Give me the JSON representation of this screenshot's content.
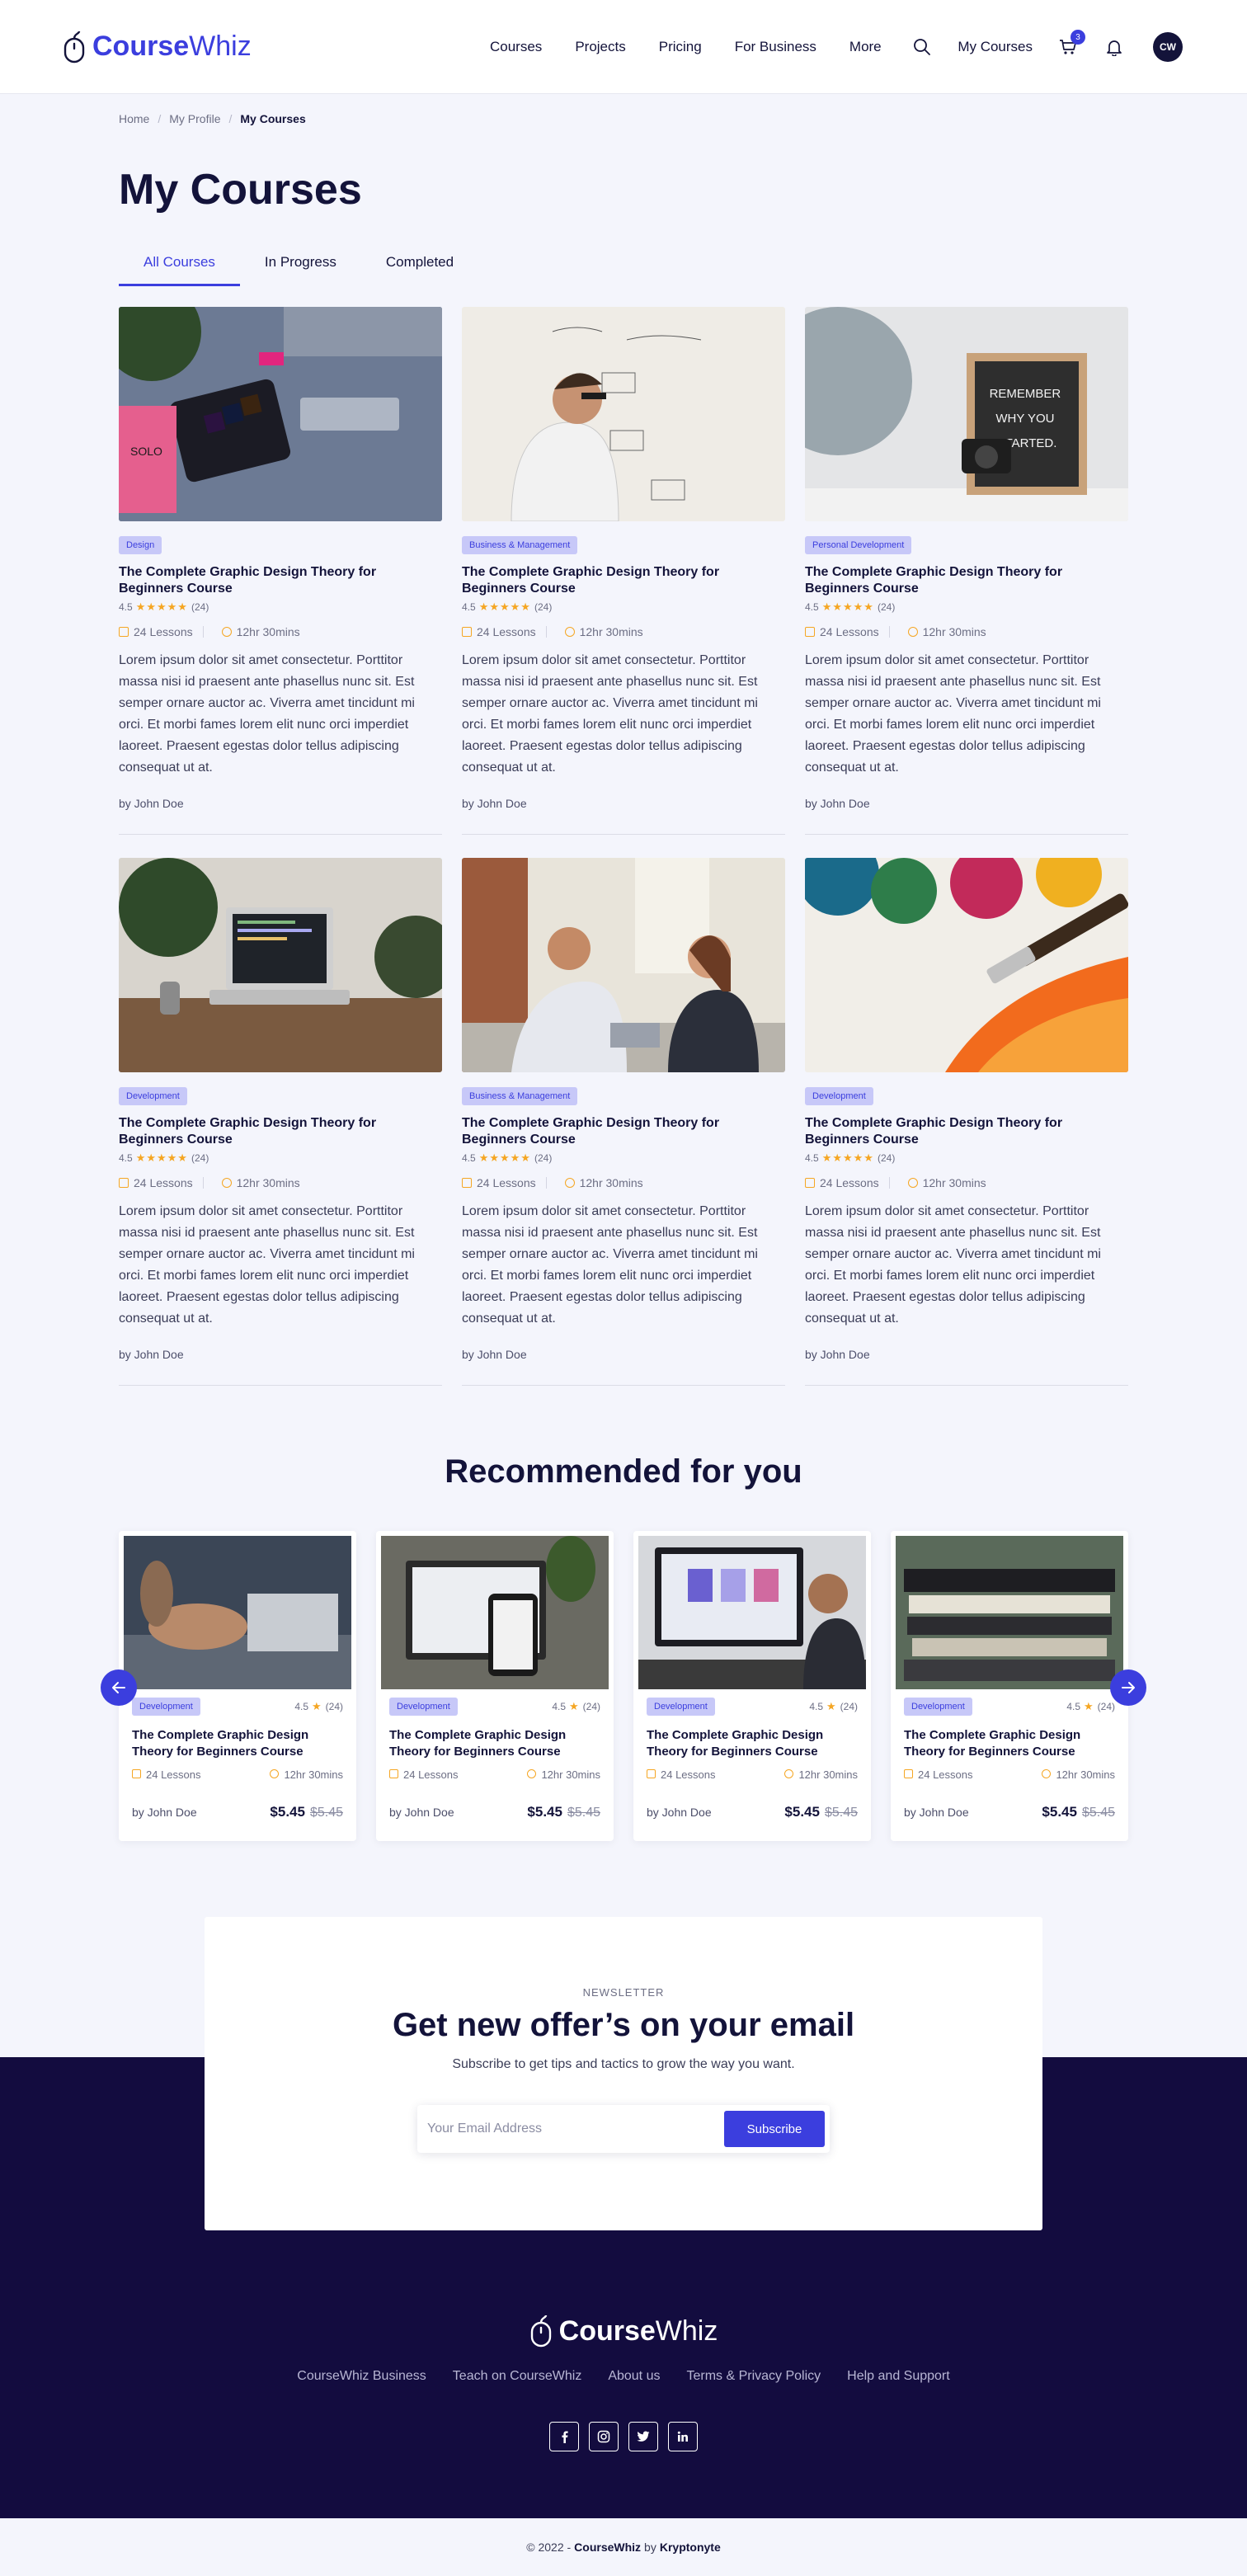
{
  "brand": {
    "name_bold": "Course",
    "name_light": "Whiz"
  },
  "nav": [
    "Courses",
    "Projects",
    "Pricing",
    "For Business",
    "More"
  ],
  "header": {
    "my_courses": "My Courses",
    "cart_count": "3",
    "avatar_initials": "CW"
  },
  "breadcrumb": [
    "Home",
    "My Profile",
    "My Courses"
  ],
  "page_title": "My Courses",
  "tabs": [
    "All Courses",
    "In Progress",
    "Completed"
  ],
  "courses": [
    {
      "category": "Design",
      "title": "The Complete Graphic Design Theory for Beginners Course",
      "rating": "4.5",
      "stars": "★★★★★",
      "reviews": "(24)",
      "lessons": "24 Lessons",
      "duration": "12hr 30mins",
      "description": "Lorem ipsum dolor sit amet consectetur. Porttitor massa nisi id praesent ante phasellus nunc sit. Est semper ornare auctor ac. Viverra amet tincidunt mi orci. Et morbi fames lorem elit nunc orci imperdiet laoreet. Praesent egestas dolor tellus adipiscing consequat ut at.",
      "author": "by John Doe"
    },
    {
      "category": "Business & Management",
      "title": "The Complete Graphic Design Theory for Beginners Course",
      "rating": "4.5",
      "stars": "★★★★★",
      "reviews": "(24)",
      "lessons": "24 Lessons",
      "duration": "12hr 30mins",
      "description": "Lorem ipsum dolor sit amet consectetur. Porttitor massa nisi id praesent ante phasellus nunc sit. Est semper ornare auctor ac. Viverra amet tincidunt mi orci. Et morbi fames lorem elit nunc orci imperdiet laoreet. Praesent egestas dolor tellus adipiscing consequat ut at.",
      "author": "by John Doe"
    },
    {
      "category": "Personal Development",
      "title": "The Complete Graphic Design Theory for Beginners Course",
      "rating": "4.5",
      "stars": "★★★★★",
      "reviews": "(24)",
      "lessons": "24 Lessons",
      "duration": "12hr 30mins",
      "description": "Lorem ipsum dolor sit amet consectetur. Porttitor massa nisi id praesent ante phasellus nunc sit. Est semper ornare auctor ac. Viverra amet tincidunt mi orci. Et morbi fames lorem elit nunc orci imperdiet laoreet. Praesent egestas dolor tellus adipiscing consequat ut at.",
      "author": "by John Doe",
      "image_text": "REMEMBER WHY YOU STARTED."
    },
    {
      "category": "Development",
      "title": "The Complete Graphic Design Theory for Beginners Course",
      "rating": "4.5",
      "stars": "★★★★★",
      "reviews": "(24)",
      "lessons": "24 Lessons",
      "duration": "12hr 30mins",
      "description": "Lorem ipsum dolor sit amet consectetur. Porttitor massa nisi id praesent ante phasellus nunc sit. Est semper ornare auctor ac. Viverra amet tincidunt mi orci. Et morbi fames lorem elit nunc orci imperdiet laoreet. Praesent egestas dolor tellus adipiscing consequat ut at.",
      "author": "by John Doe"
    },
    {
      "category": "Business & Management",
      "title": "The Complete Graphic Design Theory for Beginners Course",
      "rating": "4.5",
      "stars": "★★★★★",
      "reviews": "(24)",
      "lessons": "24 Lessons",
      "duration": "12hr 30mins",
      "description": "Lorem ipsum dolor sit amet consectetur. Porttitor massa nisi id praesent ante phasellus nunc sit. Est semper ornare auctor ac. Viverra amet tincidunt mi orci. Et morbi fames lorem elit nunc orci imperdiet laoreet. Praesent egestas dolor tellus adipiscing consequat ut at.",
      "author": "by John Doe"
    },
    {
      "category": "Development",
      "title": "The Complete Graphic Design Theory for Beginners Course",
      "rating": "4.5",
      "stars": "★★★★★",
      "reviews": "(24)",
      "lessons": "24 Lessons",
      "duration": "12hr 30mins",
      "description": "Lorem ipsum dolor sit amet consectetur. Porttitor massa nisi id praesent ante phasellus nunc sit. Est semper ornare auctor ac. Viverra amet tincidunt mi orci. Et morbi fames lorem elit nunc orci imperdiet laoreet. Praesent egestas dolor tellus adipiscing consequat ut at.",
      "author": "by John Doe"
    }
  ],
  "recommended": {
    "heading": "Recommended for you",
    "items": [
      {
        "category": "Development",
        "rating": "4.5",
        "reviews": "(24)",
        "title": "The Complete Graphic Design Theory for Beginners Course",
        "lessons": "24 Lessons",
        "duration": "12hr 30mins",
        "author": "by John Doe",
        "price": "$5.45",
        "old_price": "$5.45"
      },
      {
        "category": "Development",
        "rating": "4.5",
        "reviews": "(24)",
        "title": "The Complete Graphic Design Theory for Beginners Course",
        "lessons": "24 Lessons",
        "duration": "12hr 30mins",
        "author": "by John Doe",
        "price": "$5.45",
        "old_price": "$5.45"
      },
      {
        "category": "Development",
        "rating": "4.5",
        "reviews": "(24)",
        "title": "The Complete Graphic Design Theory for Beginners Course",
        "lessons": "24 Lessons",
        "duration": "12hr 30mins",
        "author": "by John Doe",
        "price": "$5.45",
        "old_price": "$5.45"
      },
      {
        "category": "Development",
        "rating": "4.5",
        "reviews": "(24)",
        "title": "The Complete Graphic Design Theory for Beginners Course",
        "lessons": "24 Lessons",
        "duration": "12hr 30mins",
        "author": "by John Doe",
        "price": "$5.45",
        "old_price": "$5.45"
      }
    ]
  },
  "newsletter": {
    "label": "NEWSLETTER",
    "heading": "Get new offer’s on your email",
    "subtitle": "Subscribe to get tips and tactics to grow the way you want.",
    "placeholder": "Your Email Address",
    "button": "Subscribe"
  },
  "footer": {
    "links": [
      "CourseWhiz Business",
      "Teach on CourseWhiz",
      "About us",
      "Terms & Privacy Policy",
      "Help and Support"
    ],
    "socials": [
      "facebook-icon",
      "instagram-icon",
      "twitter-icon",
      "linkedin-icon"
    ],
    "copyright_prefix": "© 2022 -",
    "copyright_brand": "CourseWhiz",
    "copyright_by": "by",
    "copyright_company": "Kryptonyte"
  },
  "colors": {
    "accent": "#3b3ede",
    "dark": "#130c3f",
    "star": "#f5a623",
    "background": "#f4f5fc"
  }
}
